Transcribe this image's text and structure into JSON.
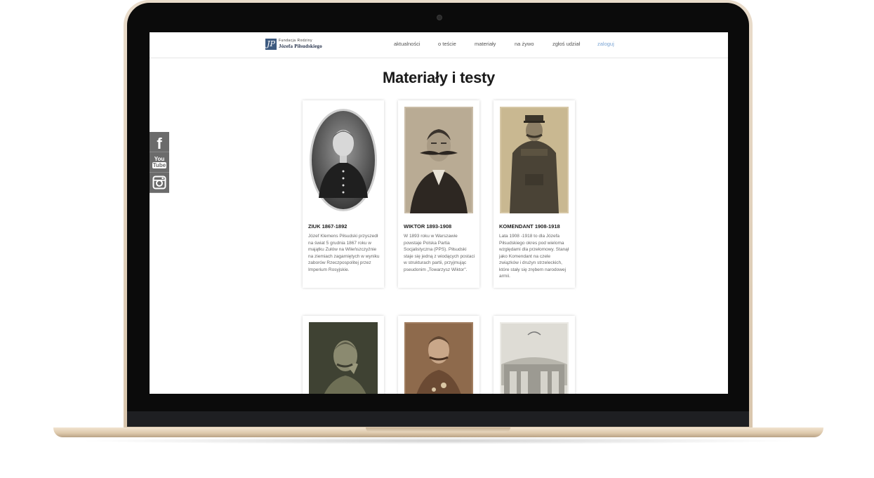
{
  "header": {
    "logo_line1": "Fundacja Rodziny",
    "logo_line2": "Józefa Piłsudskiego",
    "nav": [
      {
        "label": "aktualności",
        "active": false
      },
      {
        "label": "o teście",
        "active": false
      },
      {
        "label": "materiały",
        "active": false
      },
      {
        "label": "na żywo",
        "active": false
      },
      {
        "label": "zgłoś udział",
        "active": false
      },
      {
        "label": "zaloguj",
        "active": true
      }
    ]
  },
  "main": {
    "title": "Materiały i testy",
    "cards": [
      {
        "title": "ZIUK 1867-1892",
        "text": "Józef Klemens Piłsudski przyszedł na świat 5 grudnia 1867 roku w majątku Zułów na Wileńszczyźnie na ziemiach zagarniętych w wyniku zaborów Rzeczpospolitej przez Imperium Rosyjskie."
      },
      {
        "title": "WIKTOR 1893-1908",
        "text": "W 1893 roku w Warszawie powstaje Polska Partia Socjalistyczna (PPS). Piłsudski staje się jedną z wiodących postaci w strukturach partii, przyjmując pseudonim „Towarzysz Wiktor\"."
      },
      {
        "title": "KOMENDANT 1908-1918",
        "text": "Lata 1908 -1918 to dla Józefa Piłsudskiego okres pod wieloma względami dla przełomowy. Stanął jako Komendant na czele związków i drużyn strzeleckich, które stały się zrębem narodowej armii."
      },
      {
        "title": "",
        "text": ""
      },
      {
        "title": "",
        "text": ""
      },
      {
        "title": "",
        "text": ""
      }
    ]
  },
  "social": [
    {
      "icon": "facebook-icon",
      "label": "f"
    },
    {
      "icon": "youtube-icon",
      "label_top": "You",
      "label_bottom": "Tube"
    },
    {
      "icon": "instagram-icon"
    }
  ]
}
